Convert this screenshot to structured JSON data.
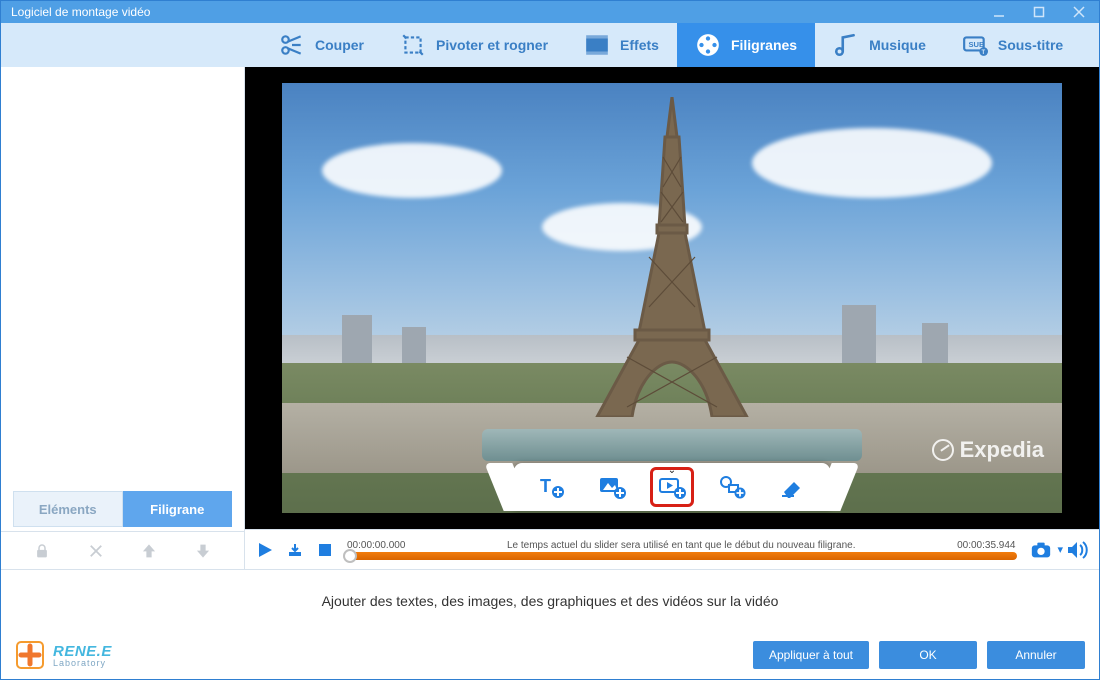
{
  "window": {
    "title": "Logiciel de montage vidéo"
  },
  "toolbar": {
    "cut": "Couper",
    "rotate": "Pivoter et rogner",
    "effects": "Effets",
    "watermarks": "Filigranes",
    "music": "Musique",
    "subtitle": "Sous-titre"
  },
  "sidebar": {
    "tab_elements": "Eléments",
    "tab_watermark": "Filigrane"
  },
  "timeline": {
    "start": "00:00:00.000",
    "end": "00:00:35.944",
    "hint": "Le temps actuel du slider sera utilisé en tant que le début du nouveau filigrane."
  },
  "preview": {
    "brand": "Expedia"
  },
  "description": "Ajouter des textes, des images, des graphiques et des vidéos sur la vidéo",
  "footer": {
    "brand_line1": "RENE.E",
    "brand_line2": "Laboratory",
    "apply_all": "Appliquer à tout",
    "ok": "OK",
    "cancel": "Annuler"
  }
}
